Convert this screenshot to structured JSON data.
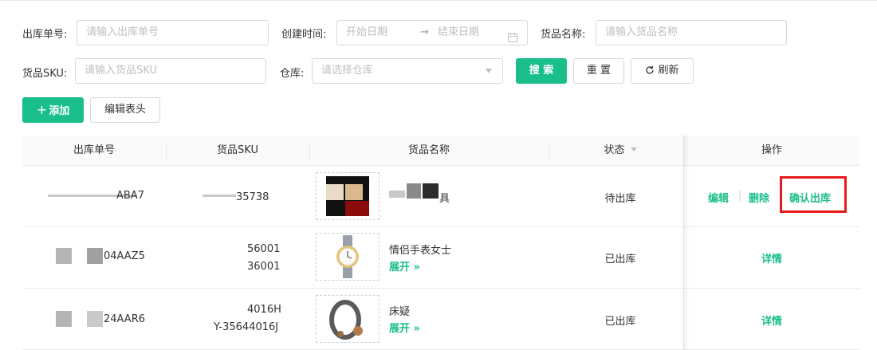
{
  "filters": {
    "order_no_label": "出库单号:",
    "order_no_placeholder": "请输入出库单号",
    "created_label": "创建时间:",
    "start_placeholder": "开始日期",
    "range_arrow": "→",
    "end_placeholder": "结束日期",
    "goods_name_label": "货品名称:",
    "goods_name_placeholder": "请输入货品名称",
    "sku_label": "货品SKU:",
    "sku_placeholder": "请输入货品SKU",
    "warehouse_label": "仓库:",
    "warehouse_placeholder": "请选择仓库",
    "search_label": "搜 索",
    "reset_label": "重 置",
    "refresh_label": "刷新"
  },
  "toolbar": {
    "add_label": "添加",
    "edit_header_label": "编辑表头"
  },
  "table": {
    "headers": [
      "出库单号",
      "货品SKU",
      "货品名称",
      "状态",
      "操作"
    ],
    "rows": [
      {
        "order_no": "ABA7",
        "sku_lines": [
          "35738"
        ],
        "goods_name": "具",
        "expand_label": "",
        "status": "待出库",
        "actions": [
          "编辑",
          "删除",
          "确认出库"
        ]
      },
      {
        "order_no": "04AAZ5",
        "sku_lines": [
          "56001",
          "36001"
        ],
        "goods_name": "情侣手表女士",
        "expand_label": "展开 »",
        "status": "已出库",
        "actions": [
          "详情"
        ]
      },
      {
        "order_no": "24AAR6",
        "sku_lines": [
          "4016H",
          "Y-35644016J"
        ],
        "goods_name": "床疑",
        "expand_label": "展开 »",
        "status": "已出库",
        "actions": [
          "详情"
        ]
      }
    ]
  },
  "colors": {
    "primary": "#19be8b",
    "highlight_box": "#e8191a"
  }
}
